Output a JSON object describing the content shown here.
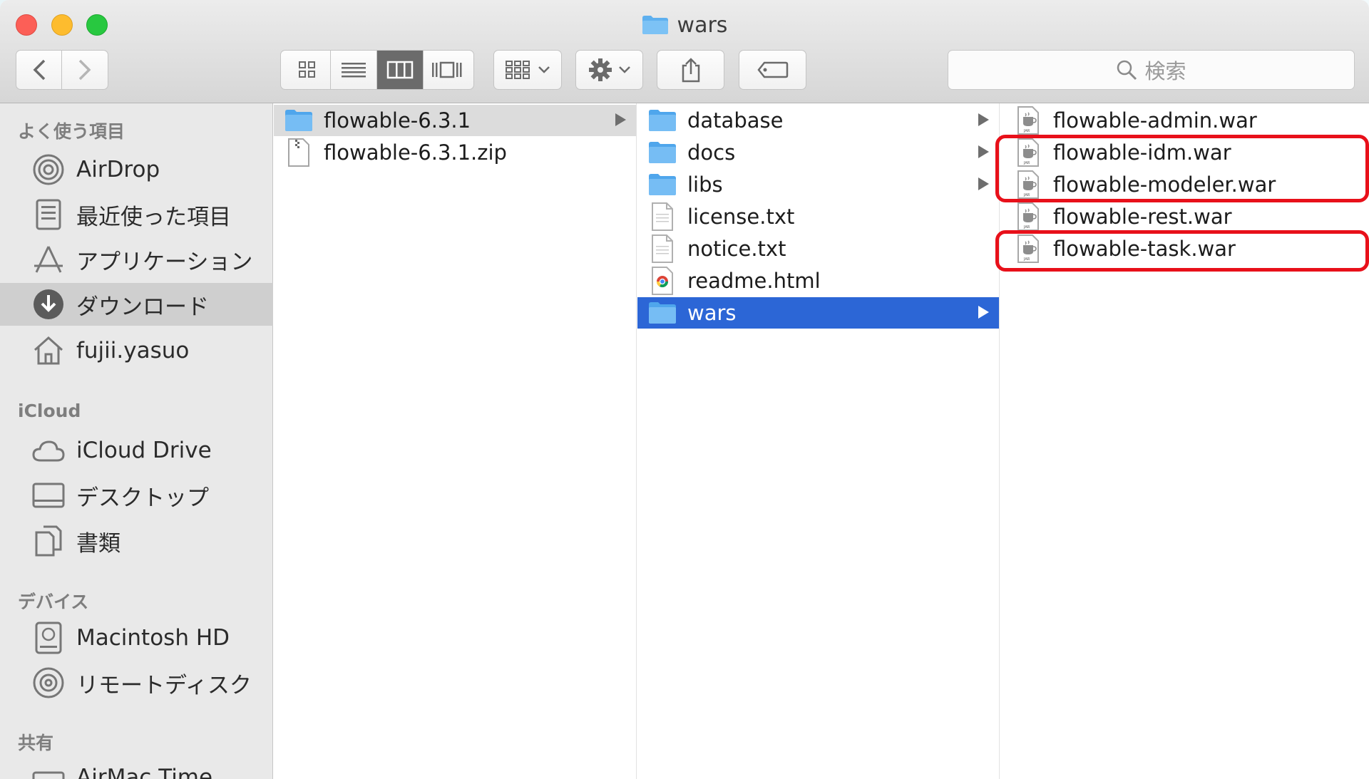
{
  "window": {
    "title": "wars"
  },
  "toolbar": {
    "search_placeholder": "検索"
  },
  "sidebar": {
    "sections": [
      {
        "label": "よく使う項目",
        "items": [
          {
            "label": "AirDrop",
            "icon": "airdrop-icon"
          },
          {
            "label": "最近使った項目",
            "icon": "recents-icon"
          },
          {
            "label": "アプリケーション",
            "icon": "applications-icon"
          },
          {
            "label": "ダウンロード",
            "icon": "downloads-icon",
            "selected": true
          },
          {
            "label": "fujii.yasuo",
            "icon": "home-icon"
          }
        ]
      },
      {
        "label": "iCloud",
        "items": [
          {
            "label": "iCloud Drive",
            "icon": "cloud-icon"
          },
          {
            "label": "デスクトップ",
            "icon": "desktop-icon"
          },
          {
            "label": "書類",
            "icon": "documents-icon"
          }
        ]
      },
      {
        "label": "デバイス",
        "items": [
          {
            "label": "Macintosh HD",
            "icon": "hard-drive-icon"
          },
          {
            "label": "リモートディスク",
            "icon": "remote-disc-icon"
          }
        ]
      },
      {
        "label": "共有",
        "items": [
          {
            "label": "AirMac Time",
            "icon": "network-drive-icon"
          }
        ]
      }
    ]
  },
  "columns": {
    "col1": [
      {
        "name": "flowable-6.3.1",
        "type": "folder",
        "selected": "gray",
        "arrow": true
      },
      {
        "name": "flowable-6.3.1.zip",
        "type": "zip"
      }
    ],
    "col2": [
      {
        "name": "database",
        "type": "folder",
        "arrow": true
      },
      {
        "name": "docs",
        "type": "folder",
        "arrow": true
      },
      {
        "name": "libs",
        "type": "folder",
        "arrow": true
      },
      {
        "name": "license.txt",
        "type": "text"
      },
      {
        "name": "notice.txt",
        "type": "text"
      },
      {
        "name": "readme.html",
        "type": "html"
      },
      {
        "name": "wars",
        "type": "folder",
        "selected": "blue",
        "arrow": true
      }
    ],
    "col3": [
      {
        "name": "flowable-admin.war",
        "type": "jar"
      },
      {
        "name": "flowable-idm.war",
        "type": "jar"
      },
      {
        "name": "flowable-modeler.war",
        "type": "jar"
      },
      {
        "name": "flowable-rest.war",
        "type": "jar"
      },
      {
        "name": "flowable-task.war",
        "type": "jar"
      }
    ]
  },
  "colors": {
    "selection_blue": "#2c66d6",
    "folder_blue": "#5eb0ef",
    "highlight_red": "#e8101a"
  }
}
